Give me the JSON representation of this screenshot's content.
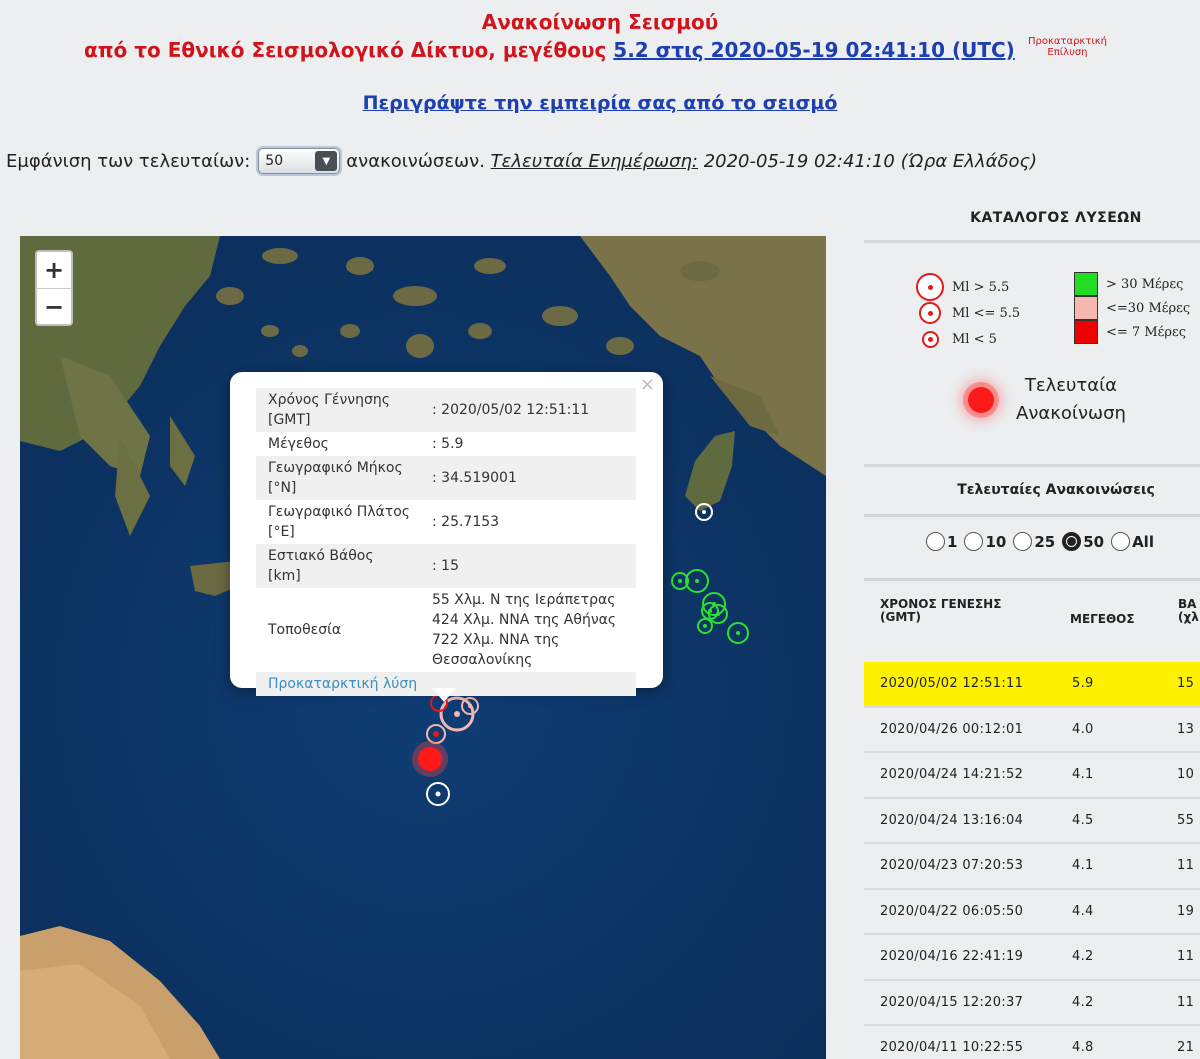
{
  "header": {
    "title": "Ανακοίνωση Σεισμού",
    "line2_prefix": "από το Εθνικό Σεισμολογικό Δίκτυο, μεγέθους ",
    "line2_link": "5.2 στις 2020-05-19 02:41:10 (UTC)",
    "prelim_line1": "Προκαταρκτική",
    "prelim_line2": "Επίλυση",
    "describe_link": "Περιγράψτε την εμπειρία σας από το σεισμό"
  },
  "show_row": {
    "label": "Εμφάνιση των τελευταίων:",
    "selected": "50",
    "after": "ανακοινώσεων.",
    "updated_label": "Τελευταία Ενημέρωση:",
    "updated_value": "2020-05-19 02:41:10 (Ώρα Ελλάδος)"
  },
  "map": {
    "zoom_in": "+",
    "zoom_out": "−",
    "popup": {
      "close": "×",
      "rows": [
        {
          "key": "Χρόνος Γέννησης [GMT]",
          "value": ": 2020/05/02 12:51:11"
        },
        {
          "key": "Μέγεθος",
          "value": ": 5.9"
        },
        {
          "key": "Γεωγραφικό Μήκος [°N]",
          "value": ": 34.519001"
        },
        {
          "key": "Γεωγραφικό Πλάτος [°E]",
          "value": ": 25.7153"
        },
        {
          "key": "Εστιακό Βάθος [km]",
          "value": ": 15"
        },
        {
          "key": "Τοποθεσία",
          "value": "55 Χλμ. Ν της Ιεράπετρας 424 Χλμ. ΝΝΑ της Αθήνας 722 Χλμ. ΝΝΑ της Θεσσαλονίκης"
        }
      ],
      "link": "Προκαταρκτική λύση"
    },
    "colors": {
      "recent": "#e21a1a",
      "medium": "#f4b6b0",
      "old": "#2ee02e"
    }
  },
  "legend": {
    "title": "ΚΑΤΑΛΟΓΟΣ ΛΥΣΕΩΝ",
    "magnitudes": [
      "Ml > 5.5",
      "Ml <= 5.5",
      "Ml < 5"
    ],
    "ages": [
      {
        "label": "> 30 Μέρες",
        "color": "#22dd22"
      },
      {
        "label": "<=30 Μέρες",
        "color": "#f5b8b0"
      },
      {
        "label": "<= 7 Μέρες",
        "color": "#ee0000"
      }
    ],
    "latest_line1": "Τελευταία",
    "latest_line2": "Ανακοίνωση"
  },
  "recent": {
    "title": "Τελευταίες Ανακοινώσεις",
    "options": [
      "1",
      "10",
      "25",
      "50",
      "All"
    ],
    "selected": "50",
    "columns": [
      "ΧΡΟΝΟΣ ΓΕΝΕΣΗΣ (GMT)",
      "ΜΕΓΕΘΟΣ",
      "ΒΑ (χλ"
    ],
    "rows": [
      {
        "date": "2020/05/02 12:51:11",
        "mag": "5.9",
        "depth": "15"
      },
      {
        "date": "2020/04/26 00:12:01",
        "mag": "4.0",
        "depth": "13"
      },
      {
        "date": "2020/04/24 14:21:52",
        "mag": "4.1",
        "depth": "10"
      },
      {
        "date": "2020/04/24 13:16:04",
        "mag": "4.5",
        "depth": "55"
      },
      {
        "date": "2020/04/23 07:20:53",
        "mag": "4.1",
        "depth": "11"
      },
      {
        "date": "2020/04/22 06:05:50",
        "mag": "4.4",
        "depth": "19"
      },
      {
        "date": "2020/04/16 22:41:19",
        "mag": "4.2",
        "depth": "11"
      },
      {
        "date": "2020/04/15 12:20:37",
        "mag": "4.2",
        "depth": "11"
      },
      {
        "date": "2020/04/11 10:22:55",
        "mag": "4.8",
        "depth": "21"
      }
    ]
  }
}
